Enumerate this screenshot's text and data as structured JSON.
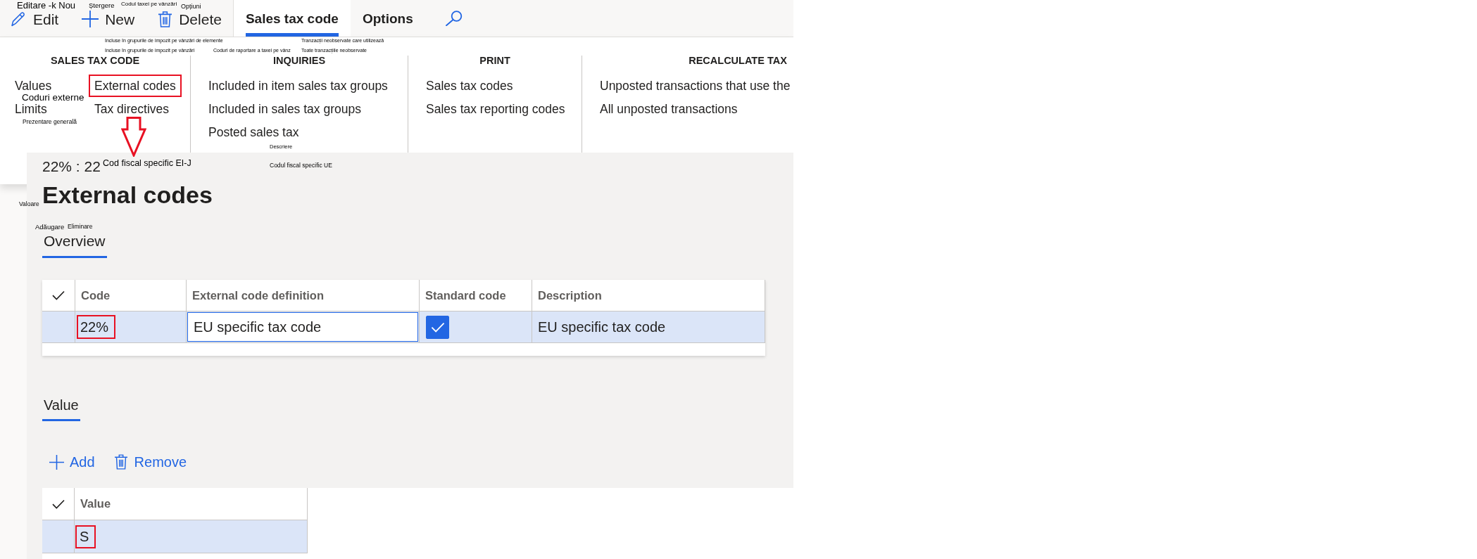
{
  "action_bar": {
    "buttons": [
      {
        "kind": "edit",
        "label": "Edit"
      },
      {
        "kind": "new",
        "label": "New"
      },
      {
        "kind": "delete",
        "label": "Delete"
      }
    ],
    "tabs": [
      {
        "label": "Sales tax code",
        "selected": true
      },
      {
        "label": "Options",
        "selected": false
      }
    ]
  },
  "ribbon": {
    "groups": [
      {
        "title": "SALES TAX CODE",
        "columns": [
          [
            {
              "label": "Values",
              "highlighted": false
            },
            {
              "label": "Limits",
              "highlighted": false
            }
          ],
          [
            {
              "label": "External codes",
              "highlighted": true
            },
            {
              "label": "Tax directives",
              "highlighted": false
            }
          ]
        ]
      },
      {
        "title": "INQUIRIES",
        "columns": [
          [
            {
              "label": "Included in item sales tax groups",
              "highlighted": false
            },
            {
              "label": "Included in sales tax groups",
              "highlighted": false
            },
            {
              "label": "Posted sales tax",
              "highlighted": false
            }
          ]
        ]
      },
      {
        "title": "PRINT",
        "columns": [
          [
            {
              "label": "Sales tax codes",
              "highlighted": false
            },
            {
              "label": "Sales tax reporting codes",
              "highlighted": false
            }
          ]
        ]
      },
      {
        "title": "RECALCULATE TAX",
        "columns": [
          [
            {
              "label": "Unposted transactions that use the",
              "highlighted": false
            },
            {
              "label": "All unposted transactions",
              "highlighted": false
            }
          ]
        ]
      }
    ]
  },
  "annotation_arrow": true,
  "flyout": {
    "record": "22% : 22",
    "title": "External codes",
    "overview_tab": {
      "label": "Overview",
      "selected": true
    },
    "codes_grid": {
      "columns": [
        "Code",
        "External code definition",
        "Standard code",
        "Description"
      ],
      "rows": [
        {
          "selected": true,
          "code": "22%",
          "code_highlighted": true,
          "external_code_definition": "EU specific tax code",
          "editing": true,
          "standard_code_checked": true,
          "description": "EU specific tax code"
        }
      ]
    },
    "value_tab": {
      "label": "Value",
      "selected": true
    },
    "value_actions": [
      {
        "kind": "add",
        "label": "Add"
      },
      {
        "kind": "remove",
        "label": "Remove"
      }
    ],
    "values_grid": {
      "columns": [
        "Value"
      ],
      "rows": [
        {
          "selected": true,
          "value": "S",
          "highlighted": true
        }
      ]
    }
  },
  "overlay_labels": [
    "Editare -k Nou",
    "Ștergere",
    "Codul taxei pe vânzări",
    "Opțiuni",
    "Incluse în grupurile de impozit pe vânzări de elemente",
    "Tranzacții neobservate care utilizează",
    "Incluse în grupurile de impozit pe vânzări",
    "Coduri de raportare a taxei pe vânz",
    "Toate tranzacțiile neobservate",
    "Coduri externe",
    "Prezentare generală",
    "Descriere",
    "Cod fiscal specific EI-J",
    "Codul fiscal specific UE",
    "Valoare",
    "Adăugare",
    "Eliminare"
  ]
}
